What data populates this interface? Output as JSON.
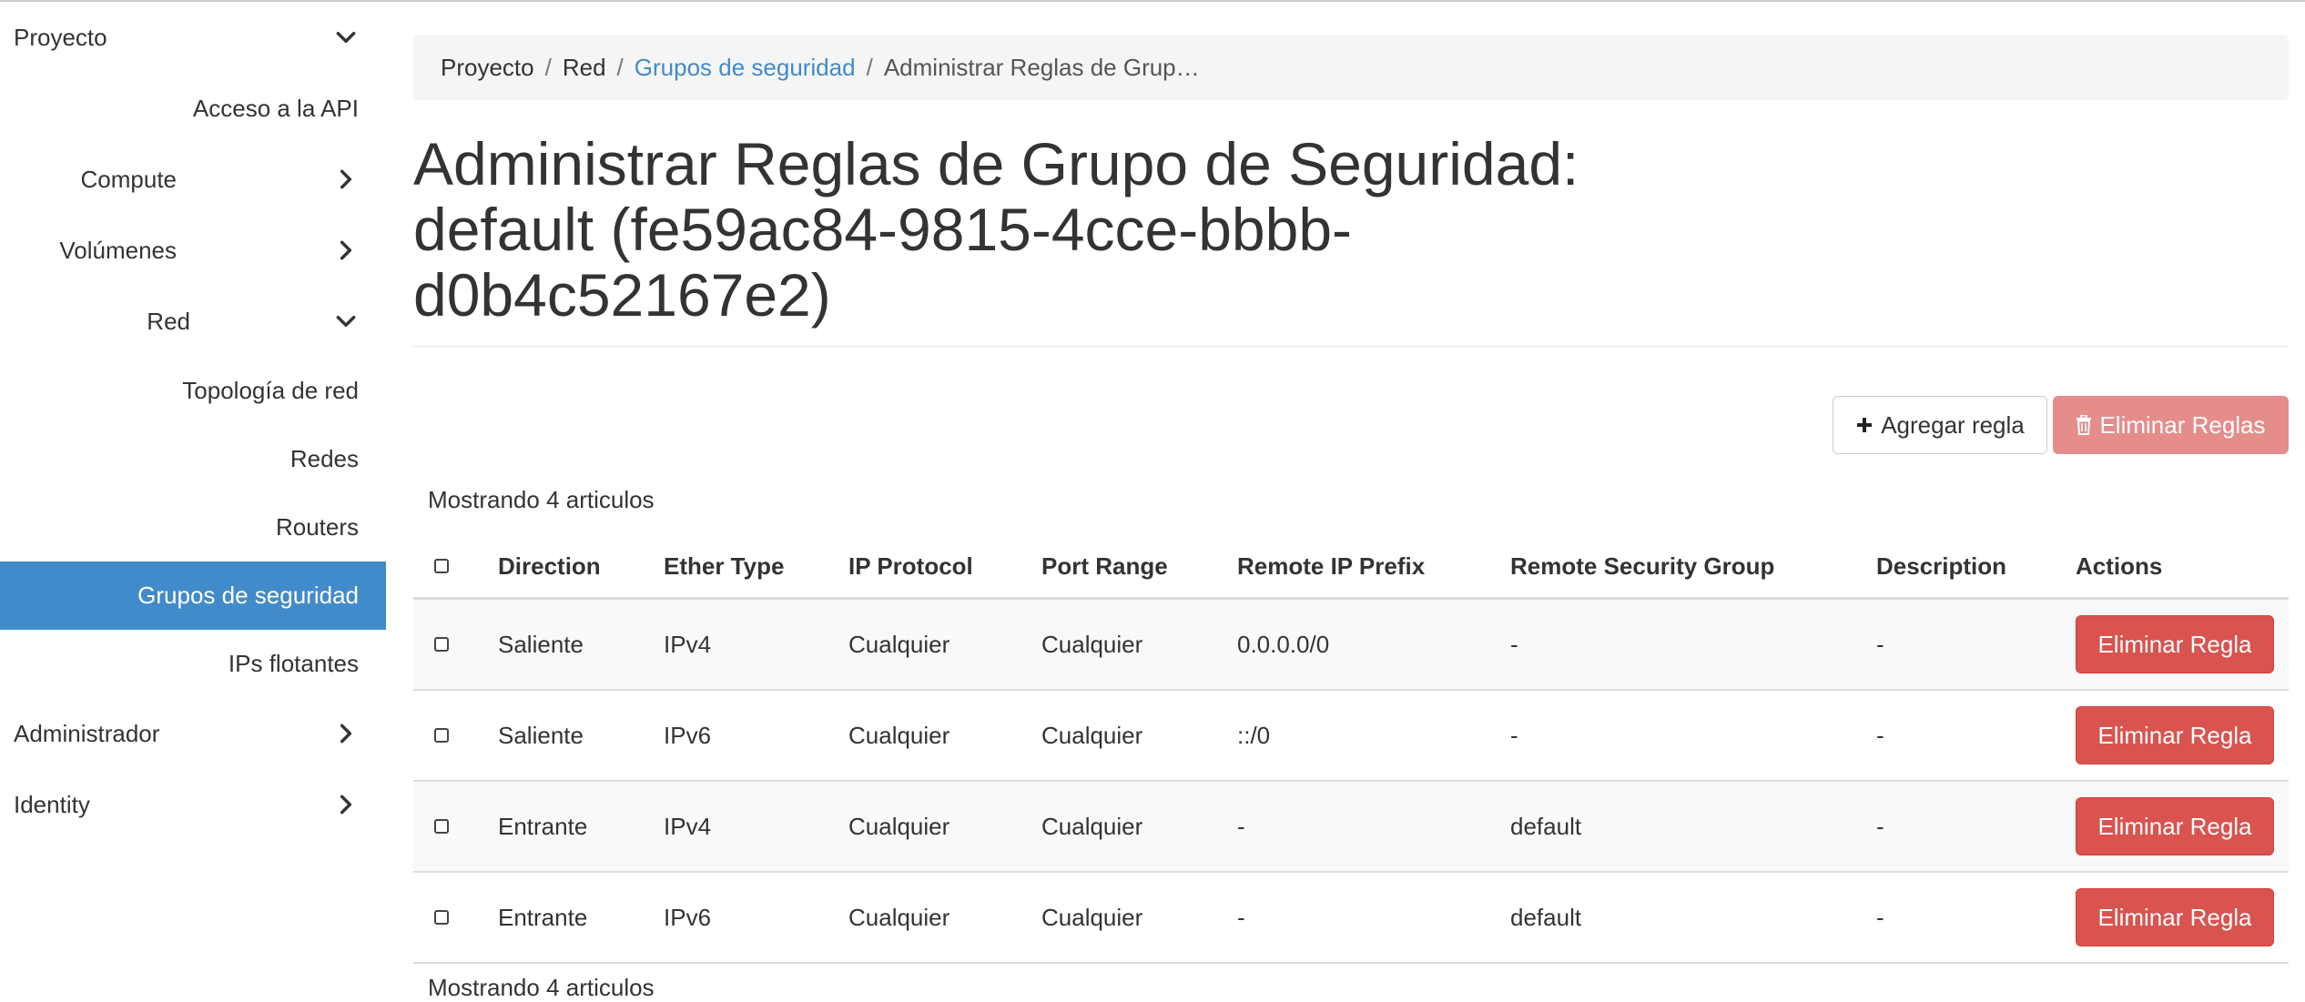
{
  "sidebar": {
    "items": [
      {
        "label": "Proyecto",
        "chevron": "down"
      },
      {
        "label": "Acceso a la API"
      },
      {
        "label": "Compute",
        "chevron": "right"
      },
      {
        "label": "Volúmenes",
        "chevron": "right"
      },
      {
        "label": "Red",
        "chevron": "down"
      },
      {
        "label": "Topología de red"
      },
      {
        "label": "Redes"
      },
      {
        "label": "Routers"
      },
      {
        "label": "Grupos de seguridad",
        "active": true
      },
      {
        "label": "IPs flotantes"
      },
      {
        "label": "Administrador",
        "chevron": "right"
      },
      {
        "label": "Identity",
        "chevron": "right"
      }
    ]
  },
  "breadcrumb": {
    "items": [
      "Proyecto",
      "Red",
      "Grupos de seguridad",
      "Administrar Reglas de Grup…"
    ],
    "separator": "/"
  },
  "page": {
    "title_line1": "Administrar Reglas de Grupo de Seguridad:",
    "title_line2": "default (fe59ac84-9815-4cce-bbbb-",
    "title_line3": "d0b4c52167e2)"
  },
  "toolbar": {
    "add_label": "Agregar regla",
    "delete_all_label": "Eliminar Reglas"
  },
  "table": {
    "count_text": "Mostrando 4 articulos",
    "columns": [
      "Direction",
      "Ether Type",
      "IP Protocol",
      "Port Range",
      "Remote IP Prefix",
      "Remote Security Group",
      "Description",
      "Actions"
    ],
    "rows": [
      {
        "direction": "Saliente",
        "ether": "IPv4",
        "protocol": "Cualquier",
        "ports": "Cualquier",
        "prefix": "0.0.0.0/0",
        "group": "-",
        "description": "-",
        "action": "Eliminar Regla"
      },
      {
        "direction": "Saliente",
        "ether": "IPv6",
        "protocol": "Cualquier",
        "ports": "Cualquier",
        "prefix": "::/0",
        "group": "-",
        "description": "-",
        "action": "Eliminar Regla"
      },
      {
        "direction": "Entrante",
        "ether": "IPv4",
        "protocol": "Cualquier",
        "ports": "Cualquier",
        "prefix": "-",
        "group": "default",
        "description": "-",
        "action": "Eliminar Regla"
      },
      {
        "direction": "Entrante",
        "ether": "IPv6",
        "protocol": "Cualquier",
        "ports": "Cualquier",
        "prefix": "-",
        "group": "default",
        "description": "-",
        "action": "Eliminar Regla"
      }
    ]
  },
  "colors": {
    "link": "#428bca",
    "active_bg": "#428bca",
    "danger": "#d9534f",
    "danger_disabled": "#e48d8b"
  },
  "icons": {
    "plus": "plus-icon",
    "trash": "trash-icon",
    "chevron_down": "chevron-down-icon",
    "chevron_right": "chevron-right-icon"
  }
}
